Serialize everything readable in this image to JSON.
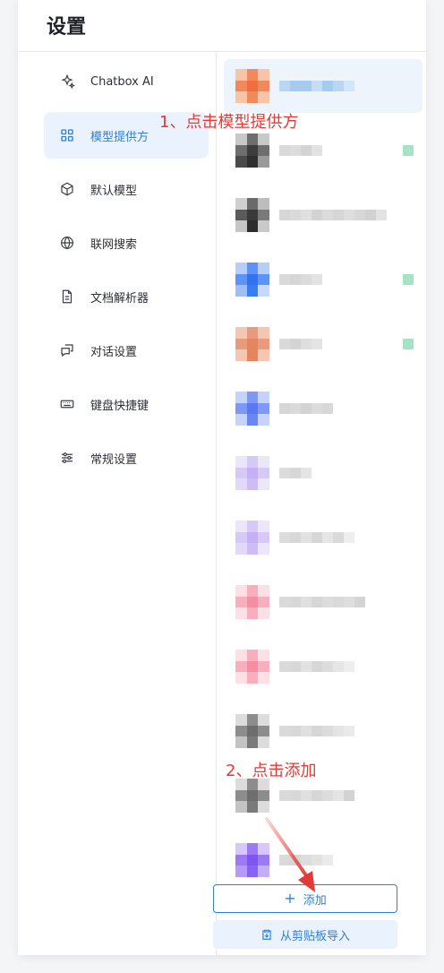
{
  "header": {
    "title": "设置"
  },
  "sidebar": {
    "items": [
      {
        "label": "Chatbox AI",
        "icon": "sparkle-icon"
      },
      {
        "label": "模型提供方",
        "icon": "grid-icon",
        "active": true
      },
      {
        "label": "默认模型",
        "icon": "cube-icon"
      },
      {
        "label": "联网搜索",
        "icon": "globe-icon"
      },
      {
        "label": "文档解析器",
        "icon": "document-icon"
      },
      {
        "label": "对话设置",
        "icon": "chat-icon"
      },
      {
        "label": "键盘快捷键",
        "icon": "keyboard-icon"
      },
      {
        "label": "常规设置",
        "icon": "sliders-icon"
      }
    ]
  },
  "providers": {
    "rows": [
      {
        "logo_colors": [
          "#f7c4a8",
          "#f08a5d",
          "#f7c4a8",
          "#f08a5d",
          "#ee6f3b",
          "#f08a5d",
          "#f7c4a8",
          "#f08a5d",
          "#f7c4a8"
        ],
        "name_colors": [
          "#b9d7f3",
          "#a7cbef",
          "#a7cbef",
          "#c4ddf5",
          "#a7cbef",
          "#b9d7f3",
          "#d3e6f8"
        ],
        "badge": false,
        "selected": true
      },
      {
        "logo_colors": [
          "#c9c9c9",
          "#6e6e6e",
          "#c9c9c9",
          "#6e6e6e",
          "#3d3d3d",
          "#6e6e6e",
          "#4a4a4a",
          "#2f2f2f",
          "#9a9a9a"
        ],
        "name_colors": [
          "#d9d9d9",
          "#dcdcdc",
          "#d4d4d4",
          "#e2e2e2"
        ],
        "badge": true
      },
      {
        "logo_colors": [
          "#cfcfcf",
          "#6a6a6a",
          "#bdbdbd",
          "#5a5a5a",
          "#3a3a3a",
          "#7a7a7a",
          "#c6c6c6",
          "#2c2c2c",
          "#c9c9c9"
        ],
        "name_colors": [
          "#d7d7d7",
          "#dadada",
          "#e0e0e0",
          "#d3d3d3",
          "#dbdbdb",
          "#d6d6d6",
          "#dedede",
          "#d8d8d8",
          "#d2d2d2",
          "#e3e3e3"
        ],
        "badge": false
      },
      {
        "logo_colors": [
          "#b6cff9",
          "#5d93f4",
          "#b6cff9",
          "#5d93f4",
          "#2f73f0",
          "#5d93f4",
          "#9fbef7",
          "#3b7cf2",
          "#c6d9fa"
        ],
        "name_colors": [
          "#d9d9d9",
          "#d6d6d6",
          "#dbdbdb",
          "#e3e3e3"
        ],
        "badge": true
      },
      {
        "logo_colors": [
          "#f3c7b2",
          "#e89a7c",
          "#f3c7b2",
          "#e89a7c",
          "#e58461",
          "#e89a7c",
          "#f3c7b2",
          "#e58461",
          "#f3c7b2"
        ],
        "name_colors": [
          "#dadada",
          "#d4d4d4",
          "#dedede",
          "#e4e4e4"
        ],
        "badge": true
      },
      {
        "logo_colors": [
          "#c5d2fa",
          "#7f98f3",
          "#c5d2fa",
          "#7f98f3",
          "#5a78ef",
          "#7f98f3",
          "#c5d2fa",
          "#6a86f1",
          "#c5d2fa"
        ],
        "name_colors": [
          "#d6d6d6",
          "#dadada",
          "#d3d3d3",
          "#dcdcdc",
          "#d8d8d8"
        ],
        "badge": false
      },
      {
        "logo_colors": [
          "#ece6fb",
          "#d6c9f6",
          "#ece6fb",
          "#d6c9f6",
          "#c3b1f3",
          "#d6c9f6",
          "#e2d8f8",
          "#cdbdf4",
          "#ece6fb"
        ],
        "name_colors": [
          "#dcdcdc",
          "#d8d8d8",
          "#e4e4e4"
        ],
        "badge": false
      },
      {
        "logo_colors": [
          "#ece6fb",
          "#d6c9f6",
          "#ece6fb",
          "#d6c9f6",
          "#c3b1f3",
          "#d6c9f6",
          "#e2d8f8",
          "#cdbdf4",
          "#ece6fb"
        ],
        "name_colors": [
          "#dcdcdc",
          "#d8d8d8",
          "#e2e2e2",
          "#d6d6d6",
          "#e6e6e6",
          "#dadada",
          "#eeeeee"
        ],
        "badge": false
      },
      {
        "logo_colors": [
          "#fce0e6",
          "#f8aebd",
          "#fce0e6",
          "#f8aebd",
          "#f48ea2",
          "#f8aebd",
          "#fce0e6",
          "#f8aebd",
          "#fce0e6"
        ],
        "name_colors": [
          "#dadada",
          "#d8d8d8",
          "#e0e0e0",
          "#d6d6d6",
          "#dcdcdc",
          "#d9d9d9",
          "#dedede",
          "#d4d4d4"
        ],
        "badge": false
      },
      {
        "logo_colors": [
          "#fce0e6",
          "#f8aebd",
          "#fce0e6",
          "#f8aebd",
          "#f48ea2",
          "#f8aebd",
          "#fce0e6",
          "#f8aebd",
          "#fce0e6"
        ],
        "name_colors": [
          "#dadada",
          "#d8d8d8",
          "#e2e2e2",
          "#d6d6d6",
          "#dcdcdc",
          "#e6e6e6",
          "#eeeeee"
        ],
        "badge": false
      },
      {
        "logo_colors": [
          "#dcdcdc",
          "#8d8d8d",
          "#dcdcdc",
          "#8d8d8d",
          "#6e6e6e",
          "#8d8d8d",
          "#c3c3c3",
          "#7a7a7a",
          "#dcdcdc"
        ],
        "name_colors": [
          "#dadada",
          "#d8d8d8",
          "#e0e0e0",
          "#d6d6d6",
          "#dcdcdc",
          "#e4e4e4",
          "#eaeaea"
        ],
        "badge": false
      },
      {
        "logo_colors": [
          "#dcdcdc",
          "#8d8d8d",
          "#dcdcdc",
          "#8d8d8d",
          "#6e6e6e",
          "#8d8d8d",
          "#c3c3c3",
          "#7a7a7a",
          "#dcdcdc"
        ],
        "name_colors": [
          "#dadada",
          "#d8d8d8",
          "#e0e0e0",
          "#d6d6d6",
          "#dcdcdc",
          "#e4e4e4",
          "#d3d3d3"
        ],
        "badge": false
      },
      {
        "logo_colors": [
          "#d8c7fb",
          "#9d7af3",
          "#d8c7fb",
          "#9d7af3",
          "#7f55f0",
          "#9d7af3",
          "#b59bf6",
          "#8a62f1",
          "#c3aef8"
        ],
        "name_colors": [
          "#d9d9d9",
          "#d6d6d6",
          "#dddddd",
          "#e2e2e2",
          "#ebebeb"
        ],
        "badge": false
      }
    ]
  },
  "actions": {
    "add_label": "添加",
    "import_label": "从剪贴板导入"
  },
  "annotations": {
    "step1": "1、点击模型提供方",
    "step2": "2、点击添加"
  },
  "colors": {
    "accent": "#2f7fd8",
    "active_bg": "#eaf3fd",
    "annotation": "#e53935"
  }
}
